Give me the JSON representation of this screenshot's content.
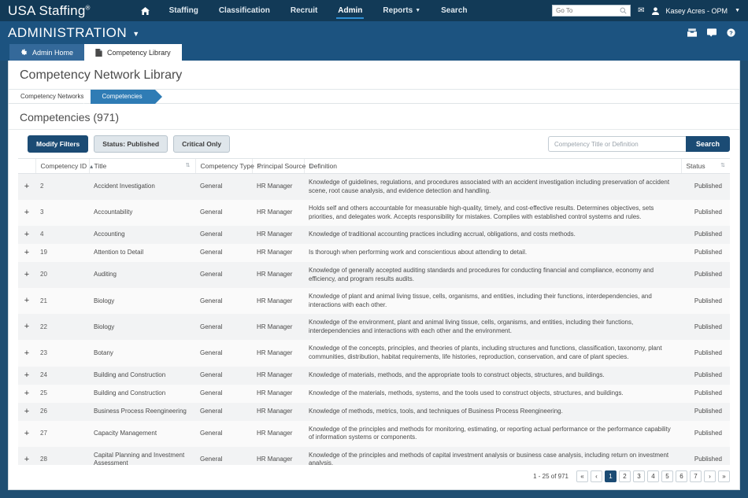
{
  "globalnav": {
    "brand": "USA Staffing",
    "brand_mark": "®",
    "items": [
      {
        "label": "Staffing",
        "active": false,
        "caret": false
      },
      {
        "label": "Classification",
        "active": false,
        "caret": false
      },
      {
        "label": "Recruit",
        "active": false,
        "caret": false
      },
      {
        "label": "Admin",
        "active": true,
        "caret": false
      },
      {
        "label": "Reports",
        "active": false,
        "caret": true
      },
      {
        "label": "Search",
        "active": false,
        "caret": false
      }
    ],
    "goto_placeholder": "Go To",
    "goto_value": "",
    "user": "Kasey Acres - OPM"
  },
  "section": {
    "title": "ADMINISTRATION"
  },
  "tabs": [
    {
      "label": "Admin Home",
      "icon": "gear-icon",
      "active": false
    },
    {
      "label": "Competency Library",
      "icon": "document-icon",
      "active": true
    }
  ],
  "page": {
    "title": "Competency Network Library"
  },
  "crumbs": [
    {
      "label": "Competency Networks",
      "active": false
    },
    {
      "label": "Competencies",
      "active": true
    }
  ],
  "list": {
    "heading": "Competencies (971)"
  },
  "toolbar": {
    "modify_filters": "Modify Filters",
    "status_filter": "Status: Published",
    "critical_filter": "Critical Only",
    "search_placeholder": "Competency Title or Definition",
    "search_value": "",
    "search_button": "Search"
  },
  "table": {
    "columns": [
      {
        "label": "",
        "sort": "none"
      },
      {
        "label": "Competency ID",
        "sort": "asc"
      },
      {
        "label": "Title",
        "sort": "both"
      },
      {
        "label": "Competency Type",
        "sort": "both"
      },
      {
        "label": "Principal Source",
        "sort": "both"
      },
      {
        "label": "Definition",
        "sort": "none"
      },
      {
        "label": "Status",
        "sort": "both"
      }
    ],
    "rows": [
      {
        "id": "2",
        "title": "Accident Investigation",
        "type": "General",
        "source": "HR Manager",
        "definition": "Knowledge of guidelines, regulations, and procedures associated with an accident investigation including preservation of accident scene, root cause analysis, and evidence detection and handling.",
        "status": "Published"
      },
      {
        "id": "3",
        "title": "Accountability",
        "type": "General",
        "source": "HR Manager",
        "definition": "Holds self and others accountable for measurable high-quality, timely, and cost-effective results. Determines objectives, sets priorities, and delegates work. Accepts responsibility for mistakes. Complies with established control systems and rules.",
        "status": "Published"
      },
      {
        "id": "4",
        "title": "Accounting",
        "type": "General",
        "source": "HR Manager",
        "definition": "Knowledge of traditional accounting practices including accrual, obligations, and costs methods.",
        "status": "Published"
      },
      {
        "id": "19",
        "title": "Attention to Detail",
        "type": "General",
        "source": "HR Manager",
        "definition": "Is thorough when performing work and conscientious about attending to detail.",
        "status": "Published"
      },
      {
        "id": "20",
        "title": "Auditing",
        "type": "General",
        "source": "HR Manager",
        "definition": "Knowledge of generally accepted auditing standards and procedures for conducting financial and compliance, economy and efficiency, and program results audits.",
        "status": "Published"
      },
      {
        "id": "21",
        "title": "Biology",
        "type": "General",
        "source": "HR Manager",
        "definition": "Knowledge of plant and animal living tissue, cells, organisms, and entities, including their functions, interdependencies, and interactions with each other.",
        "status": "Published"
      },
      {
        "id": "22",
        "title": "Biology",
        "type": "General",
        "source": "HR Manager",
        "definition": "Knowledge of the environment, plant and animal living tissue, cells, organisms, and entities, including their functions, interdependencies and interactions with each other and the environment.",
        "status": "Published"
      },
      {
        "id": "23",
        "title": "Botany",
        "type": "General",
        "source": "HR Manager",
        "definition": "Knowledge of the concepts, principles, and theories of plants, including structures and functions, classification, taxonomy, plant communities, distribution, habitat requirements, life histories, reproduction, conservation, and care of plant species.",
        "status": "Published"
      },
      {
        "id": "24",
        "title": "Building and Construction",
        "type": "General",
        "source": "HR Manager",
        "definition": "Knowledge of materials, methods, and the appropriate tools to construct objects, structures, and buildings.",
        "status": "Published"
      },
      {
        "id": "25",
        "title": "Building and Construction",
        "type": "General",
        "source": "HR Manager",
        "definition": "Knowledge of the materials, methods, systems, and the tools used to construct objects, structures, and buildings.",
        "status": "Published"
      },
      {
        "id": "26",
        "title": "Business Process Reengineering",
        "type": "General",
        "source": "HR Manager",
        "definition": "Knowledge of methods, metrics, tools, and techniques of Business Process Reengineering.",
        "status": "Published"
      },
      {
        "id": "27",
        "title": "Capacity Management",
        "type": "General",
        "source": "HR Manager",
        "definition": "Knowledge of the principles and methods for monitoring, estimating, or reporting actual performance or the performance capability of information systems or components.",
        "status": "Published"
      },
      {
        "id": "28",
        "title": "Capital Planning and Investment Assessment",
        "type": "General",
        "source": "HR Manager",
        "definition": "Knowledge of the principles and methods of capital investment analysis or business case analysis, including return on investment analysis.",
        "status": "Published"
      }
    ]
  },
  "pagination": {
    "count_label": "1 - 25 of 971",
    "first": "«",
    "prev": "‹",
    "pages": [
      "1",
      "2",
      "3",
      "4",
      "5",
      "6",
      "7"
    ],
    "current": "1",
    "next": "›",
    "last": "»"
  },
  "colors": {
    "nav_dark": "#123a57",
    "section_blue": "#1c5380",
    "accent": "#1b4b74",
    "crumb_active": "#2f7cb5",
    "tab_inactive": "#34699a"
  }
}
